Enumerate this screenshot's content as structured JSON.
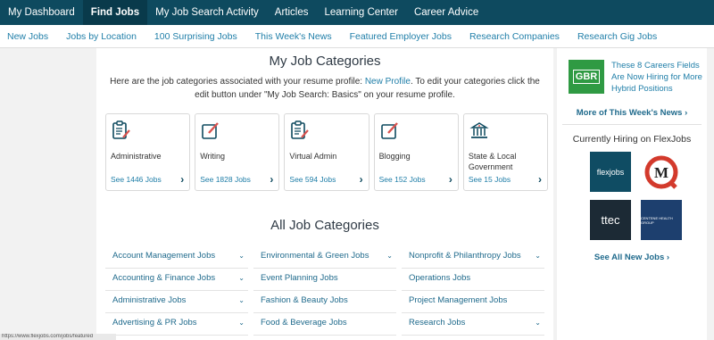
{
  "topnav": [
    {
      "label": "My Dashboard",
      "active": false
    },
    {
      "label": "Find Jobs",
      "active": true
    },
    {
      "label": "My Job Search Activity",
      "active": false
    },
    {
      "label": "Articles",
      "active": false
    },
    {
      "label": "Learning Center",
      "active": false
    },
    {
      "label": "Career Advice",
      "active": false
    }
  ],
  "subnav": [
    "New Jobs",
    "Jobs by Location",
    "100 Surprising Jobs",
    "This Week's News",
    "Featured Employer Jobs",
    "Research Companies",
    "Research Gig Jobs"
  ],
  "my_categories": {
    "title": "My Job Categories",
    "intro_before": "Here are the job categories associated with your resume profile: ",
    "intro_link": "New Profile",
    "intro_after": ". To edit your categories click the edit button under \"My Job Search: Basics\" on your resume profile.",
    "cards": [
      {
        "name": "Administrative",
        "count": "See 1446 Jobs",
        "icon": "clipboard-icon"
      },
      {
        "name": "Writing",
        "count": "See 1828 Jobs",
        "icon": "edit-icon"
      },
      {
        "name": "Virtual Admin",
        "count": "See 594 Jobs",
        "icon": "clipboard-icon"
      },
      {
        "name": "Blogging",
        "count": "See 152 Jobs",
        "icon": "edit-icon"
      },
      {
        "name": "State & Local Government",
        "count": "See 15 Jobs",
        "icon": "government-building-icon"
      }
    ]
  },
  "all_categories": {
    "title": "All Job Categories",
    "rows": [
      [
        {
          "label": "Account Management Jobs",
          "dropdown": true
        },
        {
          "label": "Environmental & Green Jobs",
          "dropdown": true
        },
        {
          "label": "Nonprofit & Philanthropy Jobs",
          "dropdown": true
        }
      ],
      [
        {
          "label": "Accounting & Finance Jobs",
          "dropdown": true
        },
        {
          "label": "Event Planning Jobs",
          "dropdown": false
        },
        {
          "label": "Operations Jobs",
          "dropdown": false
        }
      ],
      [
        {
          "label": "Administrative Jobs",
          "dropdown": true
        },
        {
          "label": "Fashion & Beauty Jobs",
          "dropdown": false
        },
        {
          "label": "Project Management Jobs",
          "dropdown": false
        }
      ],
      [
        {
          "label": "Advertising & PR Jobs",
          "dropdown": true
        },
        {
          "label": "Food & Beverage Jobs",
          "dropdown": false
        },
        {
          "label": "Research Jobs",
          "dropdown": true
        }
      ]
    ]
  },
  "sidebar": {
    "news_logo": "GBR",
    "news_text": "These 8 Careers Fields Are Now Hiring for More Hybrid Positions",
    "more_news": "More of This Week's News",
    "hiring_title": "Currently Hiring on FlexJobs",
    "companies": [
      {
        "logo_text": "flexjobs",
        "color": "#0f4c63"
      },
      {
        "logo_text": "M",
        "color": "#ffffff"
      },
      {
        "logo_text": "ttec",
        "color": "#1c2a35"
      },
      {
        "logo_text": "CENTENE HEALTH GROUP",
        "color": "#1d3f6e"
      }
    ],
    "see_all": "See All New Jobs"
  },
  "status_bar": "https://www.flexjobs.com/jobs/featured",
  "colors": {
    "nav": "#0e4a5f",
    "link": "#1f7ea8",
    "accent_red": "#d9534f"
  }
}
